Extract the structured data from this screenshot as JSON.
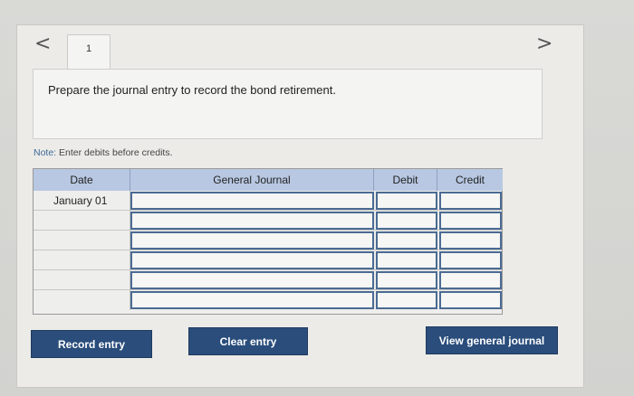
{
  "navigation": {
    "prev_glyph": "<",
    "next_glyph": ">",
    "tab_label": "1"
  },
  "prompt": {
    "text": "Prepare the journal entry to record the bond retirement."
  },
  "note": {
    "label": "Note:",
    "text": " Enter debits before credits."
  },
  "table": {
    "headers": {
      "date": "Date",
      "general_journal": "General Journal",
      "debit": "Debit",
      "credit": "Credit"
    },
    "rows": [
      {
        "date": "January 01",
        "journal": "",
        "debit": "",
        "credit": ""
      },
      {
        "date": "",
        "journal": "",
        "debit": "",
        "credit": ""
      },
      {
        "date": "",
        "journal": "",
        "debit": "",
        "credit": ""
      },
      {
        "date": "",
        "journal": "",
        "debit": "",
        "credit": ""
      },
      {
        "date": "",
        "journal": "",
        "debit": "",
        "credit": ""
      },
      {
        "date": "",
        "journal": "",
        "debit": "",
        "credit": ""
      }
    ]
  },
  "buttons": {
    "record": "Record entry",
    "clear": "Clear entry",
    "view": "View general journal"
  },
  "colors": {
    "header_bg": "#b8c8e2",
    "button_bg": "#2a4d7b",
    "input_border": "#4b6b93"
  }
}
